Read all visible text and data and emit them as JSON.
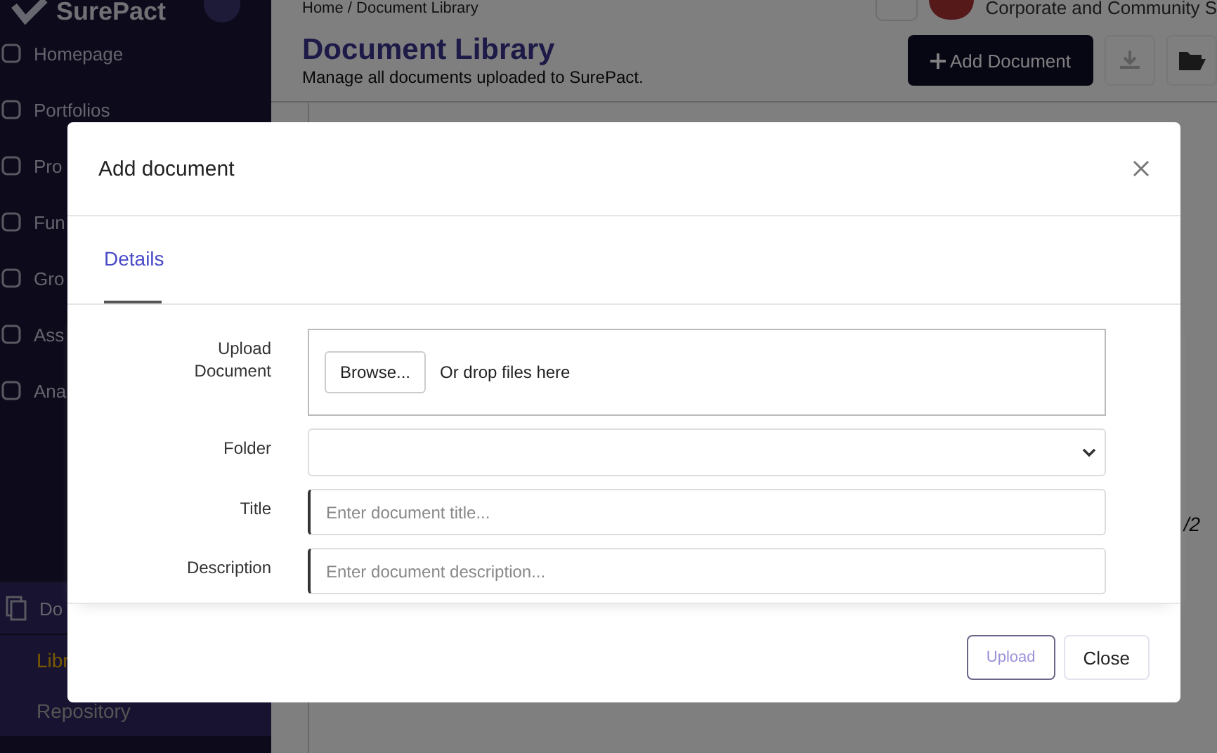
{
  "sidebar": {
    "logo": "SurePact",
    "items": [
      {
        "label": "Homepage",
        "selected": false
      },
      {
        "label": "Portfolios",
        "selected": false
      },
      {
        "label": "Pro",
        "selected": false
      },
      {
        "label": "Fun",
        "selected": false
      },
      {
        "label": "Gro",
        "selected": false
      },
      {
        "label": "Ass",
        "selected": false
      },
      {
        "label": "Ana",
        "selected": false
      }
    ],
    "group": {
      "label": "Do",
      "expanded": true,
      "children": [
        {
          "label": "Libr",
          "selected": true
        },
        {
          "label": "Repository",
          "selected": false
        }
      ]
    }
  },
  "header": {
    "breadcrumb": "Home / Document Library",
    "user": "Corporate and Community S"
  },
  "page": {
    "title": "Document Library",
    "subtitle": "Manage all documents uploaded to SurePact.",
    "add_button": "Add Document",
    "pager": "/2"
  },
  "modal": {
    "title": "Add document",
    "tabs": [
      {
        "label": "Details",
        "selected": true
      }
    ],
    "upload": {
      "label": "Upload Document",
      "browse": "Browse...",
      "hint": "Or drop files here"
    },
    "folder": {
      "label": "Folder"
    },
    "title_field": {
      "label": "Title",
      "placeholder": "Enter document title..."
    },
    "description_field": {
      "label": "Description",
      "placeholder": "Enter document description..."
    },
    "buttons": [
      {
        "label": "Upload",
        "disabled": true
      },
      {
        "label": "Close",
        "disabled": false
      }
    ]
  }
}
